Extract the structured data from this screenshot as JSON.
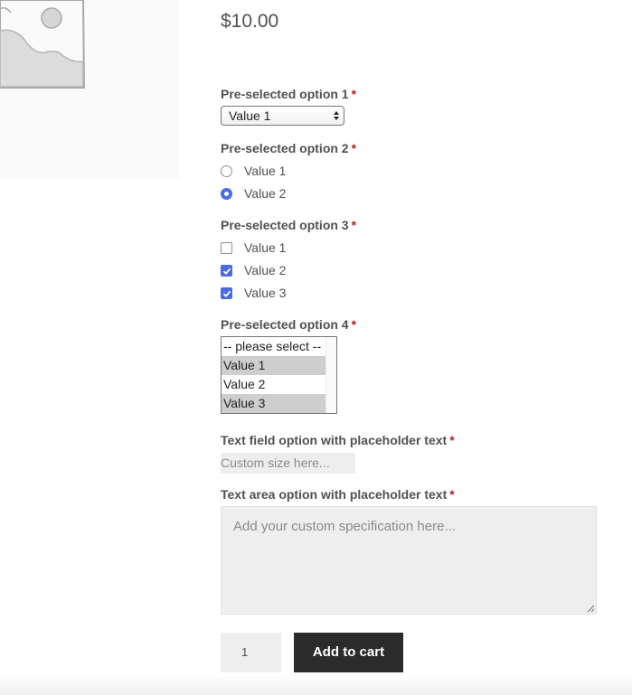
{
  "product": {
    "image_icon": "image-placeholder-icon",
    "price": "$10.00"
  },
  "options": {
    "required_marker": "*",
    "option1": {
      "label": "Pre-selected option 1",
      "selected": "Value 1"
    },
    "option2": {
      "label": "Pre-selected option 2",
      "choices": [
        {
          "label": "Value 1",
          "checked": false
        },
        {
          "label": "Value 2",
          "checked": true
        }
      ]
    },
    "option3": {
      "label": "Pre-selected option 3",
      "choices": [
        {
          "label": "Value 1",
          "checked": false
        },
        {
          "label": "Value 2",
          "checked": true
        },
        {
          "label": "Value 3",
          "checked": true
        }
      ]
    },
    "option4": {
      "label": "Pre-selected option 4",
      "items": [
        {
          "label": "-- please select --",
          "selected": false
        },
        {
          "label": "Value 1",
          "selected": true
        },
        {
          "label": "Value 2",
          "selected": false
        },
        {
          "label": "Value 3",
          "selected": true
        }
      ]
    },
    "text_field": {
      "label": "Text field option with placeholder text",
      "placeholder": "Custom size here..."
    },
    "text_area": {
      "label": "Text area option with placeholder text",
      "placeholder": "Add your custom specification here..."
    }
  },
  "cart": {
    "quantity": "1",
    "add_to_cart_label": "Add to cart"
  },
  "colors": {
    "accent": "#4c6be0",
    "required": "#b22222",
    "button_bg": "#2b2b2b",
    "field_bg": "#eeeeee"
  }
}
